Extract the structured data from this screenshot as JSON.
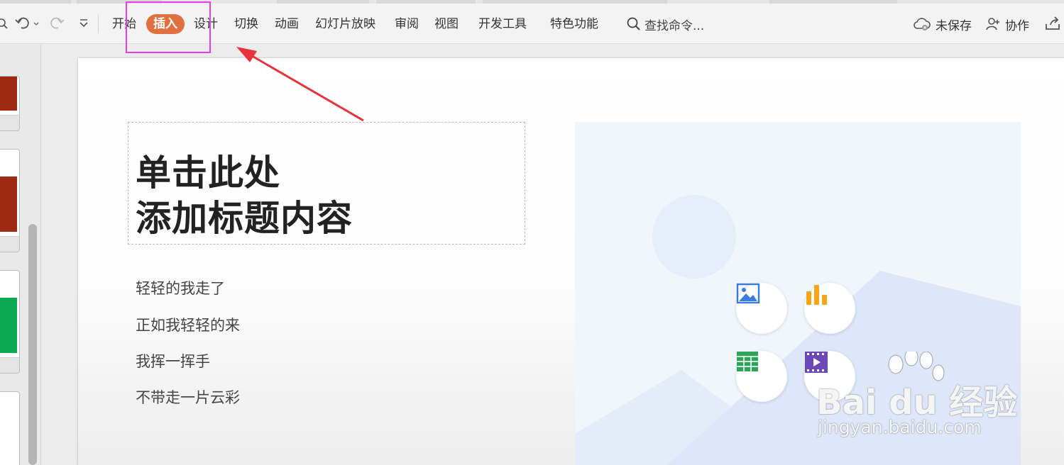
{
  "ribbon": {
    "menu": [
      {
        "label": "开始"
      },
      {
        "label": "插入"
      },
      {
        "label": "设计"
      },
      {
        "label": "切换"
      },
      {
        "label": "动画"
      },
      {
        "label": "幻灯片放映"
      },
      {
        "label": "审阅"
      },
      {
        "label": "视图"
      },
      {
        "label": "开发工具"
      },
      {
        "label": "特色功能"
      }
    ],
    "active_tab": "插入",
    "search_label": "查找命令...",
    "unsaved_label": "未保存",
    "collab_label": "协作"
  },
  "slide": {
    "title_line1": "单击此处",
    "title_line2": "添加标题内容",
    "body_lines": [
      "轻轻的我走了",
      "正如我轻轻的来",
      "我挥一挥手",
      "不带走一片云彩"
    ]
  },
  "thumbnails": [
    {
      "accent": "#9e2a12"
    },
    {
      "accent": "#9e2a12"
    },
    {
      "accent": "#0aa851"
    },
    {
      "accent": "#ffffff"
    }
  ],
  "placeholder_icons": [
    "image-icon",
    "chart-icon",
    "table-icon",
    "video-icon"
  ],
  "colors": {
    "active_tab_bg": "#e0703f",
    "highlight_box": "#e83de8",
    "arrow": "#e8333c"
  },
  "watermark": {
    "brand": "Bai du 经验",
    "url": "jingyan.baidu.com"
  }
}
